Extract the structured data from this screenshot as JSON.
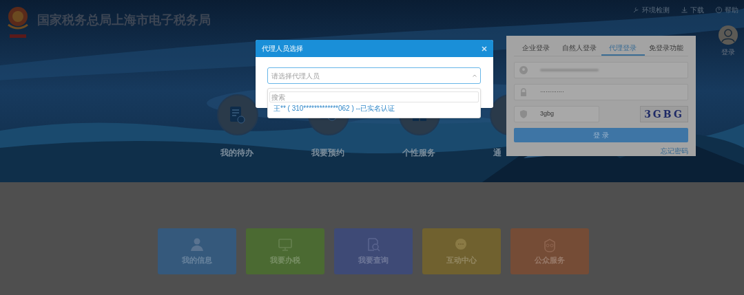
{
  "header": {
    "title": "国家税务总局上海市电子税务局",
    "links": [
      {
        "label": "环境检测"
      },
      {
        "label": "下载"
      },
      {
        "label": "帮助"
      }
    ],
    "user": {
      "label": "登录"
    }
  },
  "services": [
    {
      "label": "我的待办"
    },
    {
      "label": "我要预约"
    },
    {
      "label": "个性服务"
    },
    {
      "label": "通"
    }
  ],
  "login": {
    "tabs": [
      {
        "label": "企业登录",
        "selected": false
      },
      {
        "label": "自然人登录",
        "selected": false
      },
      {
        "label": "代理登录",
        "selected": true
      },
      {
        "label": "免登录功能",
        "selected": false
      }
    ],
    "password": "·············",
    "captcha_input": "3gbg",
    "captcha": "3GBG",
    "button": "登 录",
    "forgot": "忘记密码"
  },
  "tiles": [
    {
      "label": "我的信息",
      "color": "#35597c"
    },
    {
      "label": "我要办税",
      "color": "#4b6a32"
    },
    {
      "label": "我要查询",
      "color": "#3e4a76"
    },
    {
      "label": "互动中心",
      "color": "#70612f"
    },
    {
      "label": "公众服务",
      "color": "#754c36"
    }
  ],
  "dialog": {
    "title": "代理人员选择",
    "select": {
      "placeholder": "请选择代理人员",
      "expanded": true
    },
    "search": {
      "placeholder": "搜索"
    },
    "options": [
      "王** ( 310*************062 ) --已实名认证"
    ]
  }
}
